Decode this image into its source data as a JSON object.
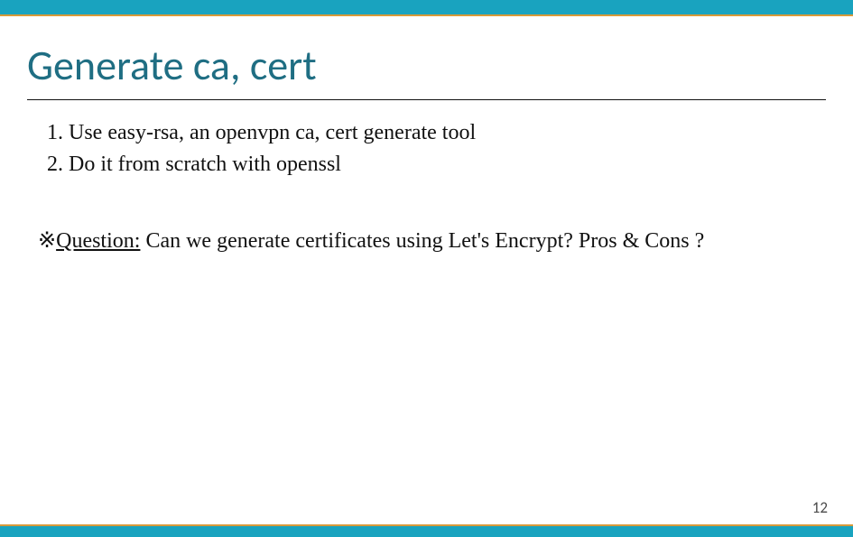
{
  "title": "Generate ca, cert",
  "list": [
    {
      "num": "1.",
      "text": "Use easy-rsa, an openvpn ca, cert generate tool"
    },
    {
      "num": "2.",
      "text": "Do it from scratch with openssl"
    }
  ],
  "question": {
    "marker": "※",
    "label": "Question:",
    "text": " Can we generate certificates using Let's Encrypt? Pros & Cons ?"
  },
  "page_number": "12"
}
